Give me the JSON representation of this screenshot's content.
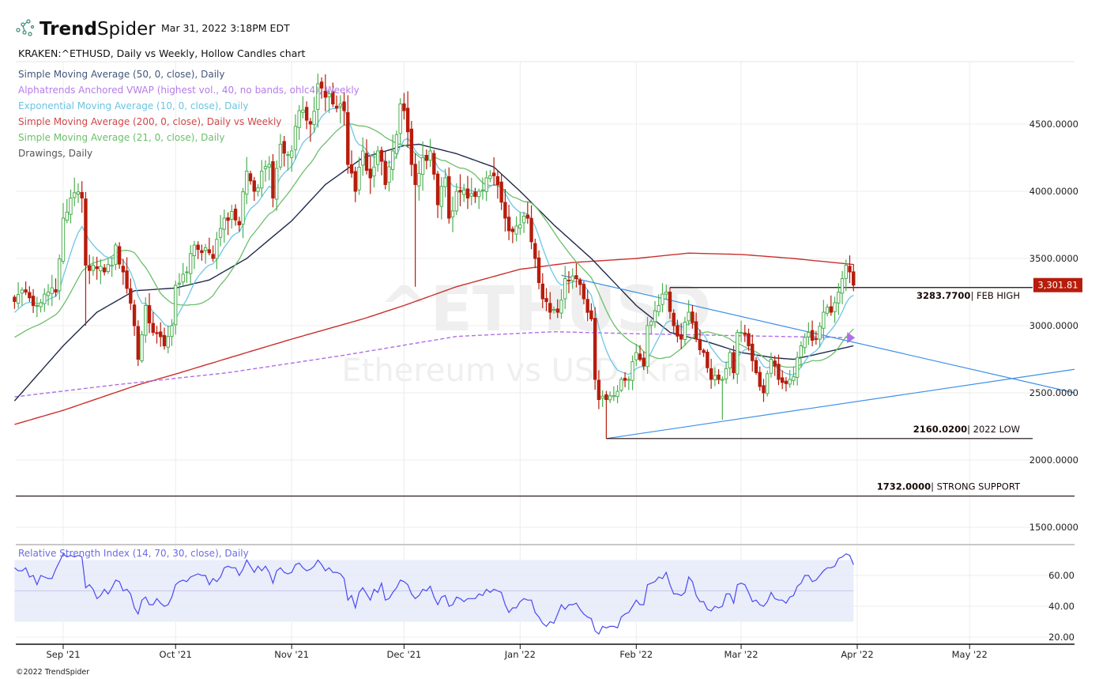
{
  "header": {
    "brand_bold": "Trend",
    "brand_light": "Spider",
    "timestamp": "Mar 31, 2022 3:18PM EDT",
    "chart_title": "KRAKEN:^ETHUSD, Daily vs Weekly, Hollow Candles chart"
  },
  "legend": [
    {
      "label": "Simple Moving Average (50, 0, close), Daily",
      "color": "#44557a"
    },
    {
      "label": "Alphatrends Anchored VWAP (highest vol., 40, no bands, ohlc4), Weekly",
      "color": "#b57ce8"
    },
    {
      "label": "Exponential Moving Average (10, 0, close), Daily",
      "color": "#6cc4e0"
    },
    {
      "label": "Simple Moving Average (200, 0, close), Daily vs Weekly",
      "color": "#d0474a"
    },
    {
      "label": "Simple Moving Average (21, 0, close), Daily",
      "color": "#6cbf6a"
    },
    {
      "label": "Drawings, Daily",
      "color": "#555555"
    }
  ],
  "watermark": {
    "symbol": "^ETHUSD",
    "name": "Ethereum vs USD, Kraken"
  },
  "last_price": {
    "label": "3,301.81",
    "value": 3301.81,
    "color": "#b71c0c"
  },
  "annotations": [
    {
      "value_label": "3283.7700",
      "text": "| FEB HIGH",
      "price": 3283.77,
      "from": "2022-02-10"
    },
    {
      "value_label": "2160.0200",
      "text": "| 2022 LOW",
      "price": 2160.02,
      "from": "2022-01-24"
    },
    {
      "value_label": "1732.0000",
      "text": "| STRONG SUPPORT",
      "price": 1732.0,
      "from": "2021-08-19"
    }
  ],
  "rsi": {
    "label": "Relative Strength Index (14, 70, 30, close), Daily",
    "upper": 70,
    "lower": 30,
    "ticks": [
      "60.00",
      "40.00",
      "20.00"
    ],
    "tick_values": [
      60,
      40,
      20
    ]
  },
  "footer": {
    "copyright": "©2022 TrendSpider"
  },
  "chart_data": {
    "type": "candlestick",
    "symbol": "KRAKEN:^ETHUSD",
    "start_date": "2021-08-19",
    "end_date": "2022-03-31",
    "x_range": [
      "2021-08-19",
      "2022-05-29"
    ],
    "ylim": [
      1350,
      5000
    ],
    "y_ticks": [
      {
        "value": 4500,
        "label": "4500.0000"
      },
      {
        "value": 4000,
        "label": "4000.0000"
      },
      {
        "value": 3500,
        "label": "3500.0000"
      },
      {
        "value": 3000,
        "label": "3000.0000"
      },
      {
        "value": 2500,
        "label": "2500.0000"
      },
      {
        "value": 2000,
        "label": "2000.0000"
      },
      {
        "value": 1500,
        "label": "1500.0000"
      }
    ],
    "x_ticks": [
      {
        "date": "2021-09-01",
        "label": "Sep '21"
      },
      {
        "date": "2021-10-01",
        "label": "Oct '21"
      },
      {
        "date": "2021-11-01",
        "label": "Nov '21"
      },
      {
        "date": "2021-12-01",
        "label": "Dec '21"
      },
      {
        "date": "2022-01-01",
        "label": "Jan '22"
      },
      {
        "date": "2022-02-01",
        "label": "Feb '22"
      },
      {
        "date": "2022-03-01",
        "label": "Mar '22"
      },
      {
        "date": "2022-04-01",
        "label": "Apr '22"
      },
      {
        "date": "2022-05-01",
        "label": "May '22"
      }
    ],
    "up_color": "#4caf50",
    "down_color": "#b71c0c",
    "close_path": [
      [
        "2021-08-19",
        3180
      ],
      [
        "2021-08-22",
        3250
      ],
      [
        "2021-08-25",
        3150
      ],
      [
        "2021-08-28",
        3250
      ],
      [
        "2021-08-30",
        3250
      ],
      [
        "2021-09-01",
        3800
      ],
      [
        "2021-09-03",
        3950
      ],
      [
        "2021-09-06",
        3950
      ],
      [
        "2021-09-07",
        3450
      ],
      [
        "2021-09-09",
        3450
      ],
      [
        "2021-09-12",
        3400
      ],
      [
        "2021-09-14",
        3450
      ],
      [
        "2021-09-15",
        3600
      ],
      [
        "2021-09-17",
        3400
      ],
      [
        "2021-09-20",
        3000
      ],
      [
        "2021-09-21",
        2750
      ],
      [
        "2021-09-23",
        3150
      ],
      [
        "2021-09-25",
        2950
      ],
      [
        "2021-09-28",
        2850
      ],
      [
        "2021-09-30",
        3000
      ],
      [
        "2021-10-01",
        3300
      ],
      [
        "2021-10-04",
        3400
      ],
      [
        "2021-10-06",
        3600
      ],
      [
        "2021-10-09",
        3580
      ],
      [
        "2021-10-11",
        3500
      ],
      [
        "2021-10-14",
        3800
      ],
      [
        "2021-10-16",
        3850
      ],
      [
        "2021-10-18",
        3750
      ],
      [
        "2021-10-20",
        4150
      ],
      [
        "2021-10-22",
        4000
      ],
      [
        "2021-10-24",
        4150
      ],
      [
        "2021-10-26",
        4200
      ],
      [
        "2021-10-27",
        3950
      ],
      [
        "2021-10-29",
        4350
      ],
      [
        "2021-11-01",
        4300
      ],
      [
        "2021-11-03",
        4600
      ],
      [
        "2021-11-06",
        4500
      ],
      [
        "2021-11-08",
        4800
      ],
      [
        "2021-11-10",
        4700
      ],
      [
        "2021-11-12",
        4650
      ],
      [
        "2021-11-14",
        4650
      ],
      [
        "2021-11-15",
        4600
      ],
      [
        "2021-11-16",
        4200
      ],
      [
        "2021-11-18",
        4000
      ],
      [
        "2021-11-20",
        4300
      ],
      [
        "2021-11-22",
        4100
      ],
      [
        "2021-11-24",
        4300
      ],
      [
        "2021-11-26",
        4050
      ],
      [
        "2021-11-28",
        4300
      ],
      [
        "2021-11-30",
        4650
      ],
      [
        "2021-12-01",
        4600
      ],
      [
        "2021-12-03",
        4200
      ],
      [
        "2021-12-04",
        4050
      ],
      [
        "2021-12-06",
        4250
      ],
      [
        "2021-12-08",
        4300
      ],
      [
        "2021-12-10",
        3900
      ],
      [
        "2021-12-12",
        4100
      ],
      [
        "2021-12-13",
        3800
      ],
      [
        "2021-12-15",
        4000
      ],
      [
        "2021-12-18",
        3950
      ],
      [
        "2021-12-21",
        4000
      ],
      [
        "2021-12-23",
        4100
      ],
      [
        "2021-12-26",
        4050
      ],
      [
        "2021-12-28",
        3800
      ],
      [
        "2021-12-30",
        3700
      ],
      [
        "2022-01-01",
        3750
      ],
      [
        "2022-01-03",
        3800
      ],
      [
        "2022-01-05",
        3500
      ],
      [
        "2022-01-07",
        3200
      ],
      [
        "2022-01-09",
        3100
      ],
      [
        "2022-01-11",
        3100
      ],
      [
        "2022-01-13",
        3350
      ],
      [
        "2022-01-16",
        3350
      ],
      [
        "2022-01-18",
        3200
      ],
      [
        "2022-01-20",
        3050
      ],
      [
        "2022-01-21",
        2600
      ],
      [
        "2022-01-22",
        2450
      ],
      [
        "2022-01-24",
        2450
      ],
      [
        "2022-01-26",
        2480
      ],
      [
        "2022-01-28",
        2600
      ],
      [
        "2022-01-30",
        2600
      ],
      [
        "2022-02-01",
        2800
      ],
      [
        "2022-02-03",
        2700
      ],
      [
        "2022-02-04",
        3000
      ],
      [
        "2022-02-07",
        3150
      ],
      [
        "2022-02-09",
        3250
      ],
      [
        "2022-02-11",
        3000
      ],
      [
        "2022-02-13",
        2900
      ],
      [
        "2022-02-15",
        3100
      ],
      [
        "2022-02-17",
        2900
      ],
      [
        "2022-02-19",
        2800
      ],
      [
        "2022-02-21",
        2600
      ],
      [
        "2022-02-23",
        2600
      ],
      [
        "2022-02-24",
        2600
      ],
      [
        "2022-02-26",
        2800
      ],
      [
        "2022-02-27",
        2650
      ],
      [
        "2022-02-28",
        2950
      ],
      [
        "2022-03-01",
        2950
      ],
      [
        "2022-03-03",
        2850
      ],
      [
        "2022-03-05",
        2650
      ],
      [
        "2022-03-07",
        2500
      ],
      [
        "2022-03-09",
        2750
      ],
      [
        "2022-03-11",
        2600
      ],
      [
        "2022-03-14",
        2600
      ],
      [
        "2022-03-15",
        2620
      ],
      [
        "2022-03-17",
        2850
      ],
      [
        "2022-03-19",
        2950
      ],
      [
        "2022-03-21",
        2900
      ],
      [
        "2022-03-23",
        3100
      ],
      [
        "2022-03-25",
        3100
      ],
      [
        "2022-03-27",
        3250
      ],
      [
        "2022-03-28",
        3350
      ],
      [
        "2022-03-29",
        3450
      ],
      [
        "2022-03-30",
        3400
      ],
      [
        "2022-03-31",
        3301.81
      ]
    ],
    "extremes": [
      {
        "date": "2021-09-07",
        "low": 3000
      },
      {
        "date": "2021-09-21",
        "low": 2700
      },
      {
        "date": "2021-11-10",
        "high": 4870
      },
      {
        "date": "2021-12-04",
        "low": 3290
      },
      {
        "date": "2022-01-24",
        "low": 2160.02
      },
      {
        "date": "2022-02-10",
        "high": 3283.77
      },
      {
        "date": "2022-02-24",
        "low": 2300
      }
    ],
    "indicators": {
      "sma50": {
        "color": "#1f2a4a",
        "points": [
          [
            "2021-08-19",
            2440
          ],
          [
            "2021-09-01",
            2850
          ],
          [
            "2021-09-10",
            3100
          ],
          [
            "2021-09-20",
            3260
          ],
          [
            "2021-10-01",
            3280
          ],
          [
            "2021-10-10",
            3340
          ],
          [
            "2021-10-20",
            3500
          ],
          [
            "2021-11-01",
            3780
          ],
          [
            "2021-11-10",
            4050
          ],
          [
            "2021-11-20",
            4250
          ],
          [
            "2021-12-01",
            4340
          ],
          [
            "2021-12-05",
            4350
          ],
          [
            "2021-12-15",
            4280
          ],
          [
            "2021-12-25",
            4180
          ],
          [
            "2022-01-01",
            4000
          ],
          [
            "2022-01-10",
            3750
          ],
          [
            "2022-01-20",
            3500
          ],
          [
            "2022-02-01",
            3150
          ],
          [
            "2022-02-10",
            2950
          ],
          [
            "2022-02-20",
            2880
          ],
          [
            "2022-03-01",
            2800
          ],
          [
            "2022-03-10",
            2760
          ],
          [
            "2022-03-15",
            2750
          ],
          [
            "2022-03-20",
            2780
          ],
          [
            "2022-03-31",
            2850
          ]
        ]
      },
      "sma200": {
        "color": "#c9302c",
        "points": [
          [
            "2021-08-19",
            2265
          ],
          [
            "2021-09-01",
            2370
          ],
          [
            "2021-09-21",
            2560
          ],
          [
            "2021-10-01",
            2640
          ],
          [
            "2021-10-20",
            2800
          ],
          [
            "2021-11-01",
            2900
          ],
          [
            "2021-11-20",
            3050
          ],
          [
            "2021-12-01",
            3150
          ],
          [
            "2021-12-15",
            3290
          ],
          [
            "2022-01-01",
            3420
          ],
          [
            "2022-01-15",
            3470
          ],
          [
            "2022-02-01",
            3500
          ],
          [
            "2022-02-15",
            3540
          ],
          [
            "2022-03-01",
            3530
          ],
          [
            "2022-03-15",
            3500
          ],
          [
            "2022-03-31",
            3455
          ]
        ]
      },
      "vwap": {
        "color": "#b06ee8",
        "points": [
          [
            "2021-08-19",
            2470
          ],
          [
            "2021-09-15",
            2560
          ],
          [
            "2021-10-15",
            2650
          ],
          [
            "2021-11-15",
            2780
          ],
          [
            "2021-12-15",
            2920
          ],
          [
            "2022-01-10",
            2955
          ],
          [
            "2022-02-01",
            2940
          ],
          [
            "2022-03-01",
            2925
          ],
          [
            "2022-03-31",
            2910
          ]
        ]
      },
      "ema10": {
        "color": "#6ec6e6",
        "period": 10,
        "seed": 3080
      },
      "sma21": {
        "color": "#6cbf6a",
        "period": 21,
        "seed": 2900
      }
    },
    "trendlines": [
      {
        "color": "#3d8fe8",
        "from": [
          "2022-01-12",
          3375
        ],
        "to": [
          "2022-05-29",
          2500
        ]
      },
      {
        "color": "#3d8fe8",
        "from": [
          "2022-01-24",
          2160.02
        ],
        "to": [
          "2022-05-29",
          2675
        ]
      }
    ],
    "rsi_values": [
      65,
      63,
      63,
      65,
      59,
      60,
      54,
      60,
      59,
      58,
      58,
      64,
      69,
      74,
      72,
      73,
      72,
      73,
      72,
      52,
      54,
      51,
      45,
      47,
      51,
      48,
      52,
      57,
      56,
      50,
      51,
      48,
      39,
      35,
      44,
      46,
      41,
      41,
      45,
      42,
      40,
      41,
      46,
      54,
      56,
      57,
      56,
      59,
      60,
      61,
      60,
      60,
      54,
      58,
      56,
      59,
      65,
      66,
      65,
      65,
      60,
      64,
      70,
      66,
      62,
      66,
      63,
      66,
      62,
      55,
      63,
      65,
      62,
      61,
      62,
      67,
      68,
      65,
      63,
      64,
      66,
      70,
      67,
      63,
      65,
      62,
      62,
      61,
      58,
      44,
      47,
      39,
      49,
      52,
      48,
      44,
      51,
      49,
      55,
      44,
      45,
      49,
      52,
      57,
      56,
      54,
      48,
      45,
      47,
      51,
      50,
      53,
      46,
      41,
      46,
      47,
      40,
      41,
      46,
      45,
      43,
      45,
      45,
      45,
      48,
      47,
      51,
      49,
      51,
      50,
      49,
      41,
      36,
      39,
      39,
      43,
      45,
      44,
      44,
      36,
      33,
      29,
      27,
      30,
      29,
      35,
      41,
      38,
      41,
      41,
      42,
      38,
      35,
      33,
      32,
      24,
      22,
      27,
      26,
      27,
      27,
      26,
      33,
      35,
      36,
      40,
      44,
      41,
      41,
      54,
      55,
      56,
      59,
      58,
      62,
      54,
      48,
      48,
      47,
      49,
      59,
      56,
      47,
      43,
      43,
      38,
      37,
      40,
      39,
      40,
      48,
      48,
      42,
      54,
      55,
      54,
      49,
      43,
      44,
      41,
      40,
      43,
      49,
      45,
      44,
      44,
      42,
      46,
      47,
      53,
      55,
      60,
      60,
      56,
      57,
      60,
      63,
      65,
      65,
      66,
      71,
      72,
      74,
      73,
      67
    ]
  }
}
